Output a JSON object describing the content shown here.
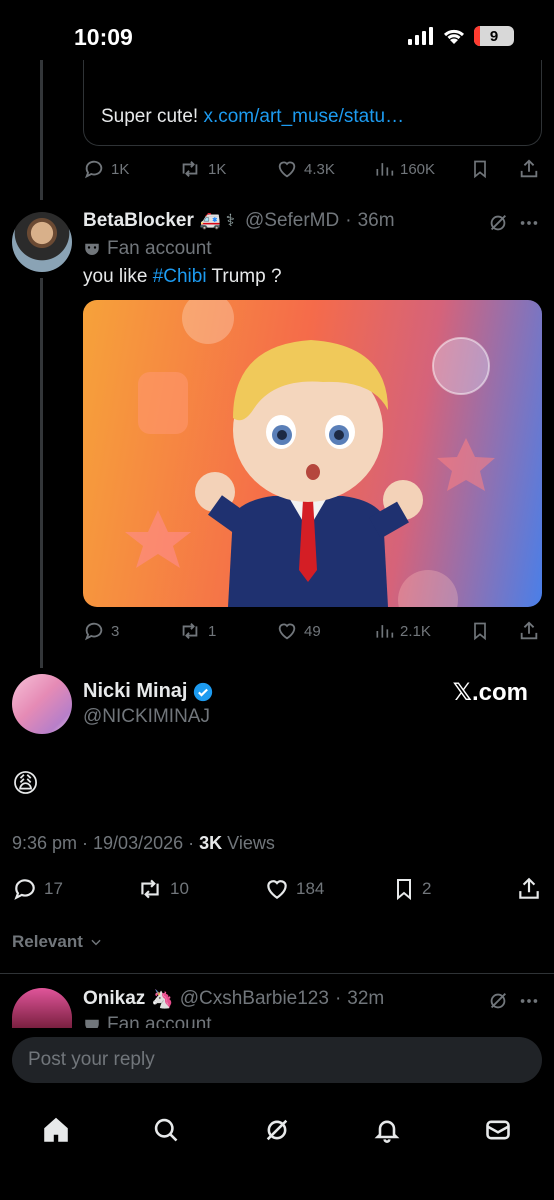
{
  "status_bar": {
    "time": "10:09",
    "battery": "9"
  },
  "quoted_post": {
    "text": "Super cute! ",
    "link": "x.com/art_muse/statu…",
    "stats": {
      "replies": "1K",
      "reposts": "1K",
      "likes": "4.3K",
      "views": "160K"
    }
  },
  "reply_post": {
    "name": "BetaBlocker",
    "emoji": "🚑 ⚕",
    "handle": "@SeferMD",
    "time": "36m",
    "badge_label": "Fan account",
    "text_before": "you like ",
    "hashtag": "#Chibi",
    "text_after": " Trump ?",
    "stats": {
      "replies": "3",
      "reposts": "1",
      "likes": "49",
      "views": "2.1K"
    }
  },
  "main_post": {
    "name": "Nicki Minaj",
    "handle": "@NICKIMINAJ",
    "brand": "𝕏.com",
    "body": "😩",
    "timestamp": "9:36 pm · 19/03/2026 · ",
    "views_count": "3K",
    "views_label": " Views",
    "stats": {
      "replies": "17",
      "reposts": "10",
      "likes": "184",
      "bookmarks": "2"
    }
  },
  "sort": {
    "label": "Relevant"
  },
  "next_reply": {
    "name": "Onikaz",
    "emoji": "🦄",
    "handle": "@CxshBarbie123",
    "time": "32m",
    "badge_label": "Fan account"
  },
  "reply_input": {
    "placeholder": "Post your reply"
  },
  "colors": {
    "accent": "#1d9bf0",
    "background": "#000000",
    "muted": "#71767b"
  }
}
